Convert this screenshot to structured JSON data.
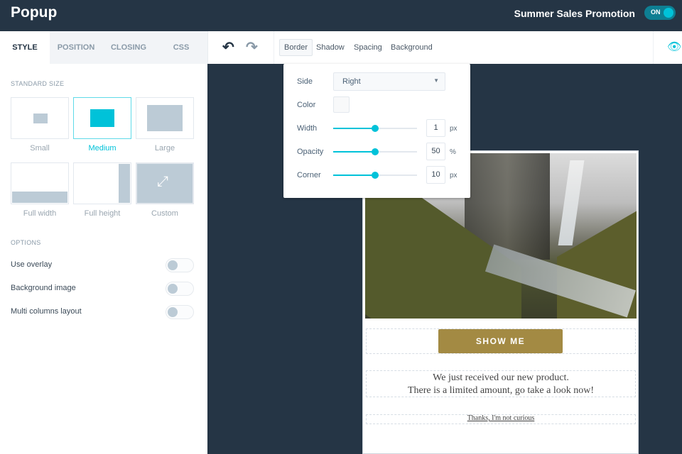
{
  "header": {
    "title": "Popup",
    "campaign": "Summer Sales Promotion",
    "toggle_label": "ON",
    "toggle_on": true
  },
  "tabs": [
    {
      "label": "STYLE",
      "active": true
    },
    {
      "label": "POSITION"
    },
    {
      "label": "CLOSING"
    },
    {
      "label": "CSS"
    }
  ],
  "left": {
    "standard_size_title": "STANDARD SIZE",
    "sizes": [
      {
        "label": "Small"
      },
      {
        "label": "Medium",
        "selected": true
      },
      {
        "label": "Large"
      },
      {
        "label": "Full width"
      },
      {
        "label": "Full height"
      },
      {
        "label": "Custom"
      }
    ],
    "options_title": "OPTIONS",
    "options": [
      {
        "label": "Use overlay",
        "on": false
      },
      {
        "label": "Background image",
        "on": false
      },
      {
        "label": "Multi columns layout",
        "on": false
      }
    ]
  },
  "toolbar": {
    "tabs": [
      "Border",
      "Shadow",
      "Spacing",
      "Background"
    ],
    "active": "Border"
  },
  "border_panel": {
    "side_label": "Side",
    "side_value": "Right",
    "color_label": "Color",
    "color_value": "#f8f9fa",
    "width": {
      "label": "Width",
      "value": "1",
      "unit": "px",
      "fraction": 0.5
    },
    "opacity": {
      "label": "Opacity",
      "value": "50",
      "unit": "%",
      "fraction": 0.5
    },
    "corner": {
      "label": "Corner",
      "value": "10",
      "unit": "px",
      "fraction": 0.5
    }
  },
  "popup": {
    "button": "SHOW ME",
    "line1": "We just received our new product.",
    "line2": "There is a limited amount, go take a look now!",
    "dismiss": "Thanks, I'm not curious"
  },
  "colors": {
    "accent": "#00c2d9",
    "header": "#253545",
    "button": "#a38a43"
  }
}
